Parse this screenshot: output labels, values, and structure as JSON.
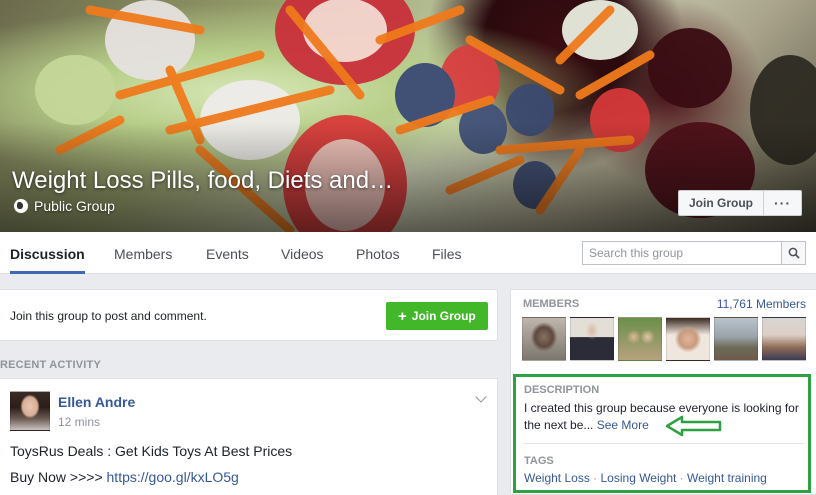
{
  "group": {
    "title": "Weight Loss Pills, food, Diets and…",
    "privacy": "Public Group",
    "join_label": "Join Group",
    "more_label": "···"
  },
  "tabs": [
    {
      "label": "Discussion",
      "active": true
    },
    {
      "label": "Members"
    },
    {
      "label": "Events"
    },
    {
      "label": "Videos"
    },
    {
      "label": "Photos"
    },
    {
      "label": "Files"
    }
  ],
  "search": {
    "placeholder": "Search this group"
  },
  "join_prompt": {
    "text": "Join this group to post and comment.",
    "button_label": "Join Group",
    "button_icon": "+"
  },
  "recent_activity": {
    "label": "RECENT ACTIVITY"
  },
  "post": {
    "author": "Ellen Andre",
    "time": "12 mins",
    "line1": "ToysRus Deals : Get Kids Toys At Best Prices",
    "line2_prefix": "Buy Now >>>> ",
    "link": "https://goo.gl/kxLO5g"
  },
  "members": {
    "heading": "MEMBERS",
    "count": "11,761 Members"
  },
  "description": {
    "heading": "DESCRIPTION",
    "text": "I created this group because everyone is looking for the next be...",
    "see_more": "See More"
  },
  "tags": {
    "heading": "TAGS",
    "items": [
      "Weight Loss",
      "Losing Weight",
      "Weight training"
    ],
    "separator": "·"
  },
  "colors": {
    "accent": "#4267b2",
    "link": "#365899",
    "join_green": "#42b72a",
    "highlight_box": "#2ea142"
  }
}
